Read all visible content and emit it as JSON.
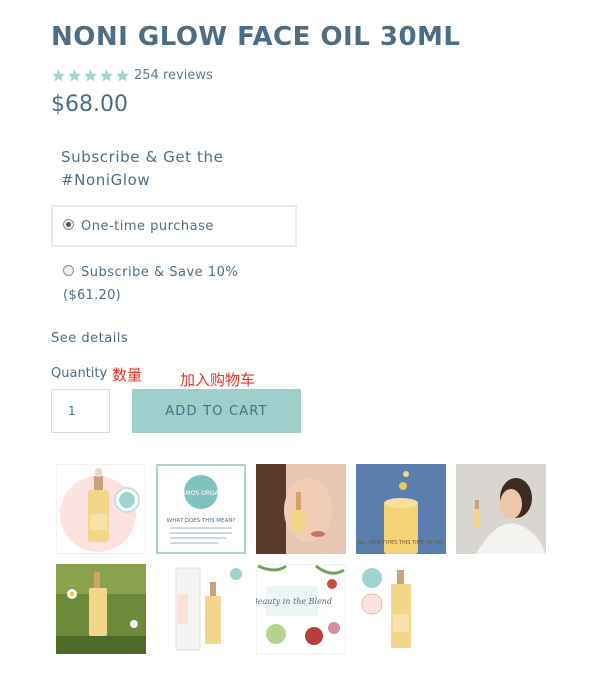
{
  "product": {
    "title": "NONI GLOW FACE OIL 30ML",
    "rating": 5,
    "reviews": "254 reviews",
    "price": "$68.00"
  },
  "subscription": {
    "heading": "Subscribe & Get the #NoniGlow",
    "options": [
      {
        "label": "One-time purchase",
        "selected": true
      },
      {
        "label": "Subscribe & Save 10%",
        "sub": "($61.20)",
        "selected": false
      }
    ],
    "details_link": "See details"
  },
  "purchase": {
    "quantity_label": "Quantity",
    "quantity_annotation": "数量",
    "quantity_value": "1",
    "cart_annotation": "加入购物车",
    "cart_button": "ADD TO CART"
  },
  "gallery": {
    "thumb2": {
      "badge": "COSMOS ORGANIC",
      "heading": "WHAT DOES THIS MEAN?"
    },
    "thumb4": {
      "caption": "ALL SKIN TYPES THIS TIME OF DAY"
    },
    "thumb8": {
      "heading": "Beauty in the Blend"
    }
  },
  "colors": {
    "accent": "#9fcfcd",
    "text": "#4e6d84",
    "star": "#9fd3cf",
    "annotation": "#e8342b"
  },
  "icons": {
    "star": "star-icon",
    "radio": "radio-icon"
  }
}
